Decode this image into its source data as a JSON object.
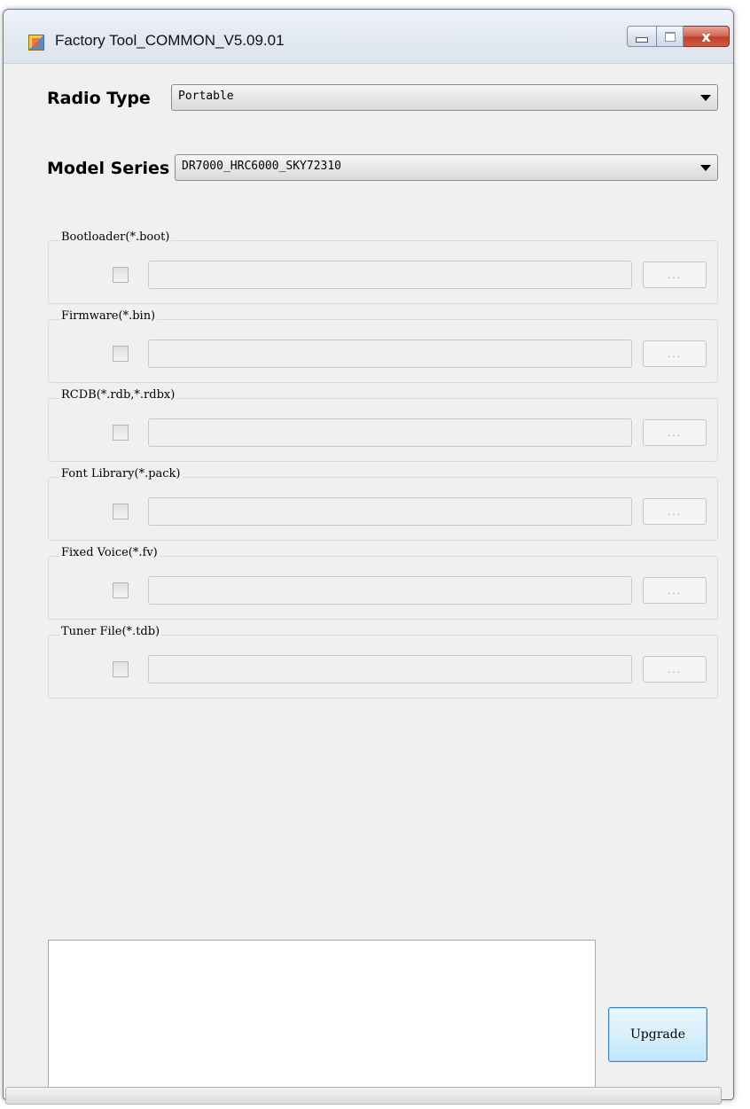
{
  "window": {
    "title": "Factory Tool_COMMON_V5.09.01",
    "icon": "app-icon",
    "buttons": {
      "minimize_icon": "minimize-icon",
      "maximize_icon": "maximize-icon",
      "close_label": "x"
    }
  },
  "radio_type": {
    "label": "Radio Type",
    "value": "Portable"
  },
  "model_series": {
    "label": "Model Series",
    "value": "DR7000_HRC6000_SKY72310"
  },
  "file_groups": [
    {
      "label": "Bootloader(*.boot)",
      "checked": false,
      "path": "",
      "browse_label": "..."
    },
    {
      "label": "Firmware(*.bin)",
      "checked": false,
      "path": "",
      "browse_label": "..."
    },
    {
      "label": "RCDB(*.rdb,*.rdbx)",
      "checked": false,
      "path": "",
      "browse_label": "..."
    },
    {
      "label": "Font Library(*.pack)",
      "checked": false,
      "path": "",
      "browse_label": "..."
    },
    {
      "label": "Fixed Voice(*.fv)",
      "checked": false,
      "path": "",
      "browse_label": "..."
    },
    {
      "label": "Tuner File(*.tdb)",
      "checked": false,
      "path": "",
      "browse_label": "..."
    }
  ],
  "log": {
    "text": ""
  },
  "upgrade_button": {
    "label": "Upgrade"
  },
  "progress": {
    "value": 0
  },
  "colors": {
    "accent": "#3c7fb1",
    "close": "#c2402a",
    "window_bg": "#f0f0f0"
  }
}
